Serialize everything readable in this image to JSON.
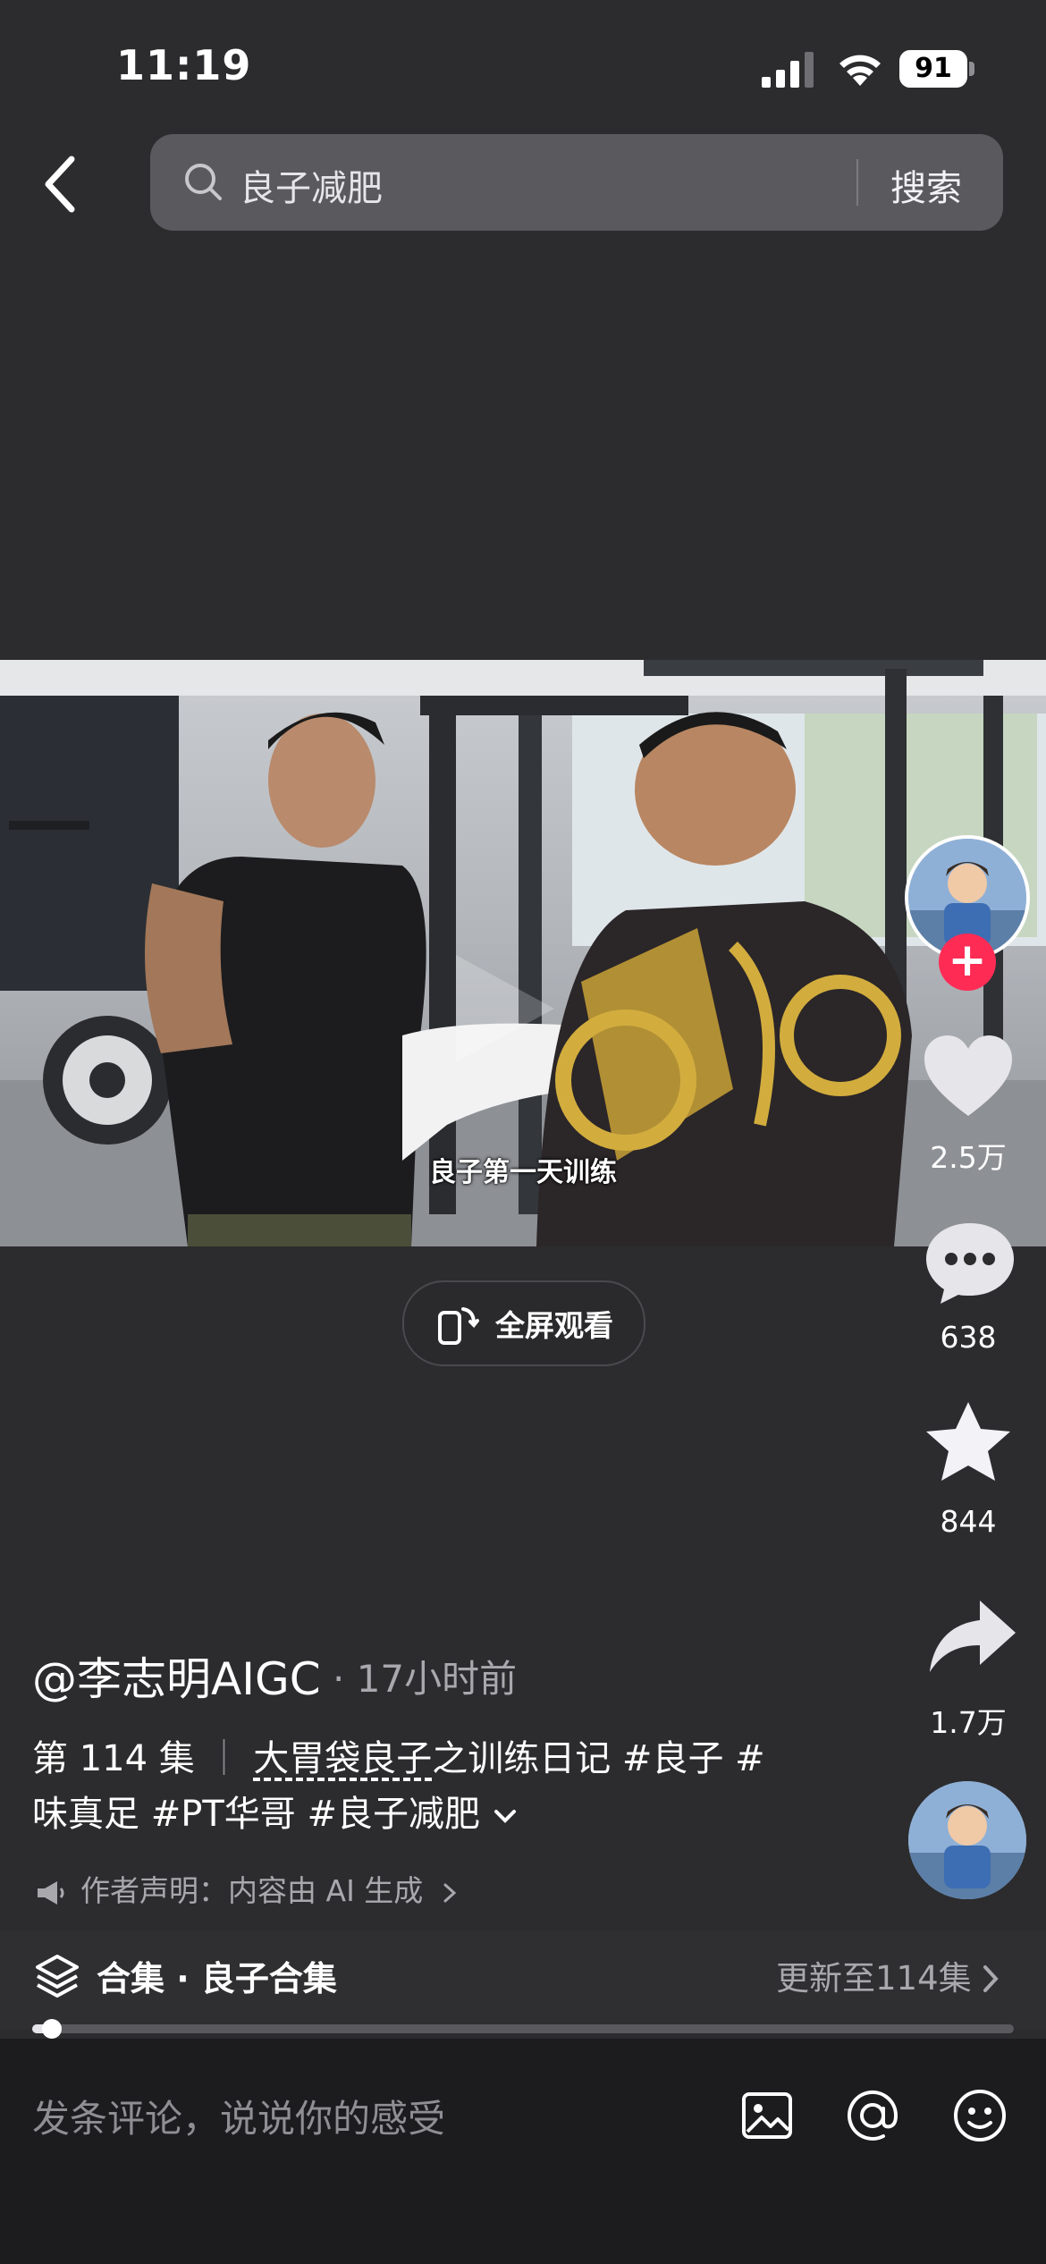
{
  "status_bar": {
    "time": "11:19",
    "battery": "91",
    "icons": [
      "cellular-signal-icon",
      "wifi-icon",
      "battery-icon"
    ]
  },
  "header": {
    "back_icon": "chevron-left-icon",
    "search_query": "良子减肥",
    "search_button": "搜索"
  },
  "video": {
    "subtitle": "良子第一天训练",
    "fullscreen_label": "全屏观看"
  },
  "actions": {
    "likes": "2.5万",
    "comments": "638",
    "favorites": "844",
    "shares": "1.7万"
  },
  "post": {
    "author": "@李志明AIGC",
    "time_ago": "17小时前",
    "desc_line1_prefix": "第 114 集",
    "desc_line1_link": "大胃袋良子",
    "desc_line1_rest": "之训练日记 #良子 #",
    "desc_line2": "味真足 #PT华哥 #良子减肥",
    "disclaimer": "作者声明：内容由 AI 生成"
  },
  "collection": {
    "label": "合集 · 良子合集",
    "update": "更新至114集",
    "progress": 0.02
  },
  "comment_bar": {
    "placeholder": "发条评论，说说你的感受"
  },
  "colors": {
    "background": "#2c2c2e",
    "accent": "#fe2c55",
    "bottom_bar": "#1c1c1e"
  }
}
